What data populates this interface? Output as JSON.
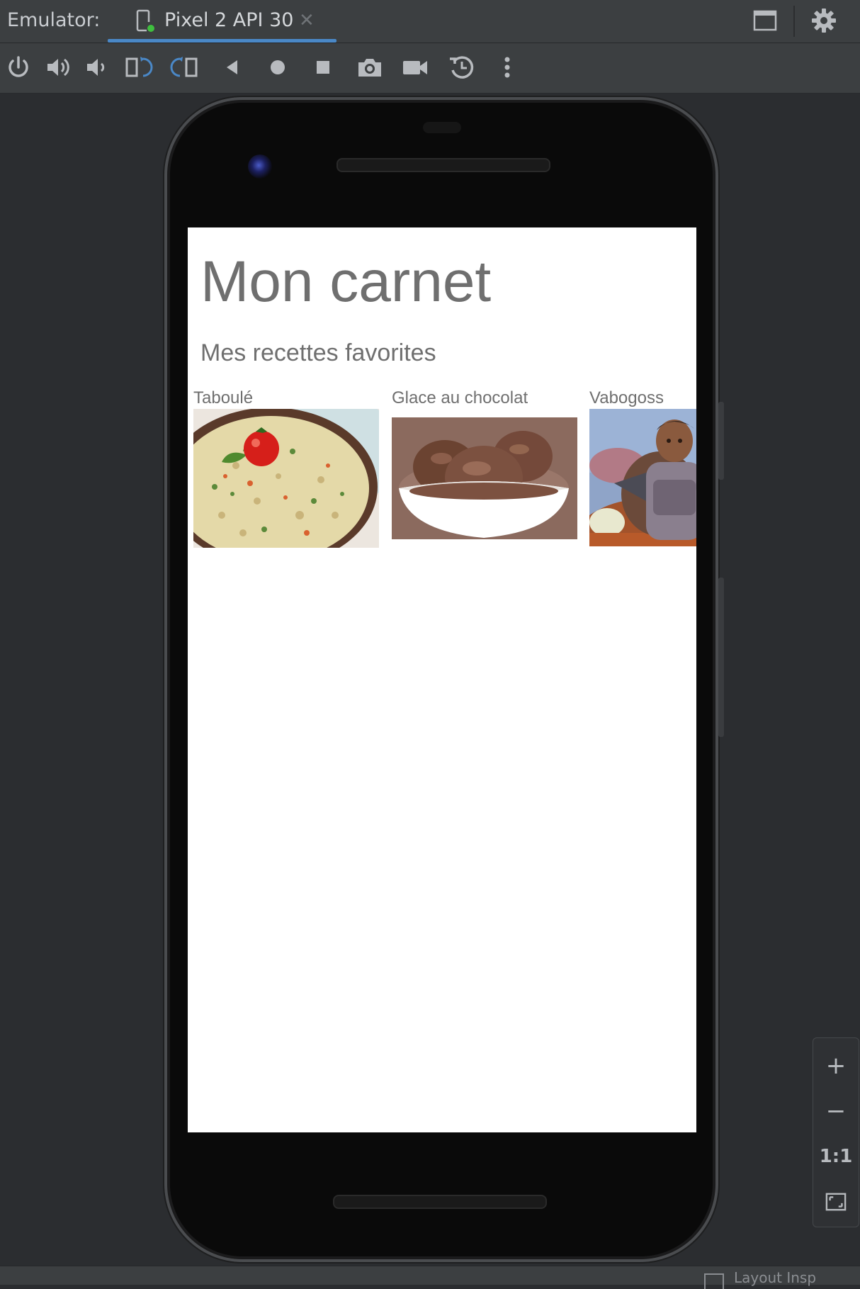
{
  "tabbar": {
    "label": "Emulator:",
    "tab_title": "Pixel 2 API 30",
    "tab_close": "✕"
  },
  "toolbar": {
    "items": [
      "power",
      "volume-up",
      "volume-down",
      "rotate-left",
      "rotate-right",
      "back",
      "home",
      "overview",
      "screenshot",
      "screen-record",
      "snapshot",
      "more"
    ]
  },
  "app": {
    "title": "Mon carnet",
    "subtitle": "Mes recettes favorites",
    "recipes": [
      {
        "label": "Taboulé"
      },
      {
        "label": "Glace au chocolat"
      },
      {
        "label": "Vabogoss"
      }
    ]
  },
  "zoom": {
    "plus": "+",
    "minus": "−",
    "one_to_one": "1:1"
  },
  "statusbar": {
    "text": "Layout Insp"
  },
  "colors": {
    "accent": "#4a88c7",
    "ide_bg": "#2b2d30",
    "toolbar_bg": "#3c3f41",
    "app_text": "#6f6f6f"
  }
}
